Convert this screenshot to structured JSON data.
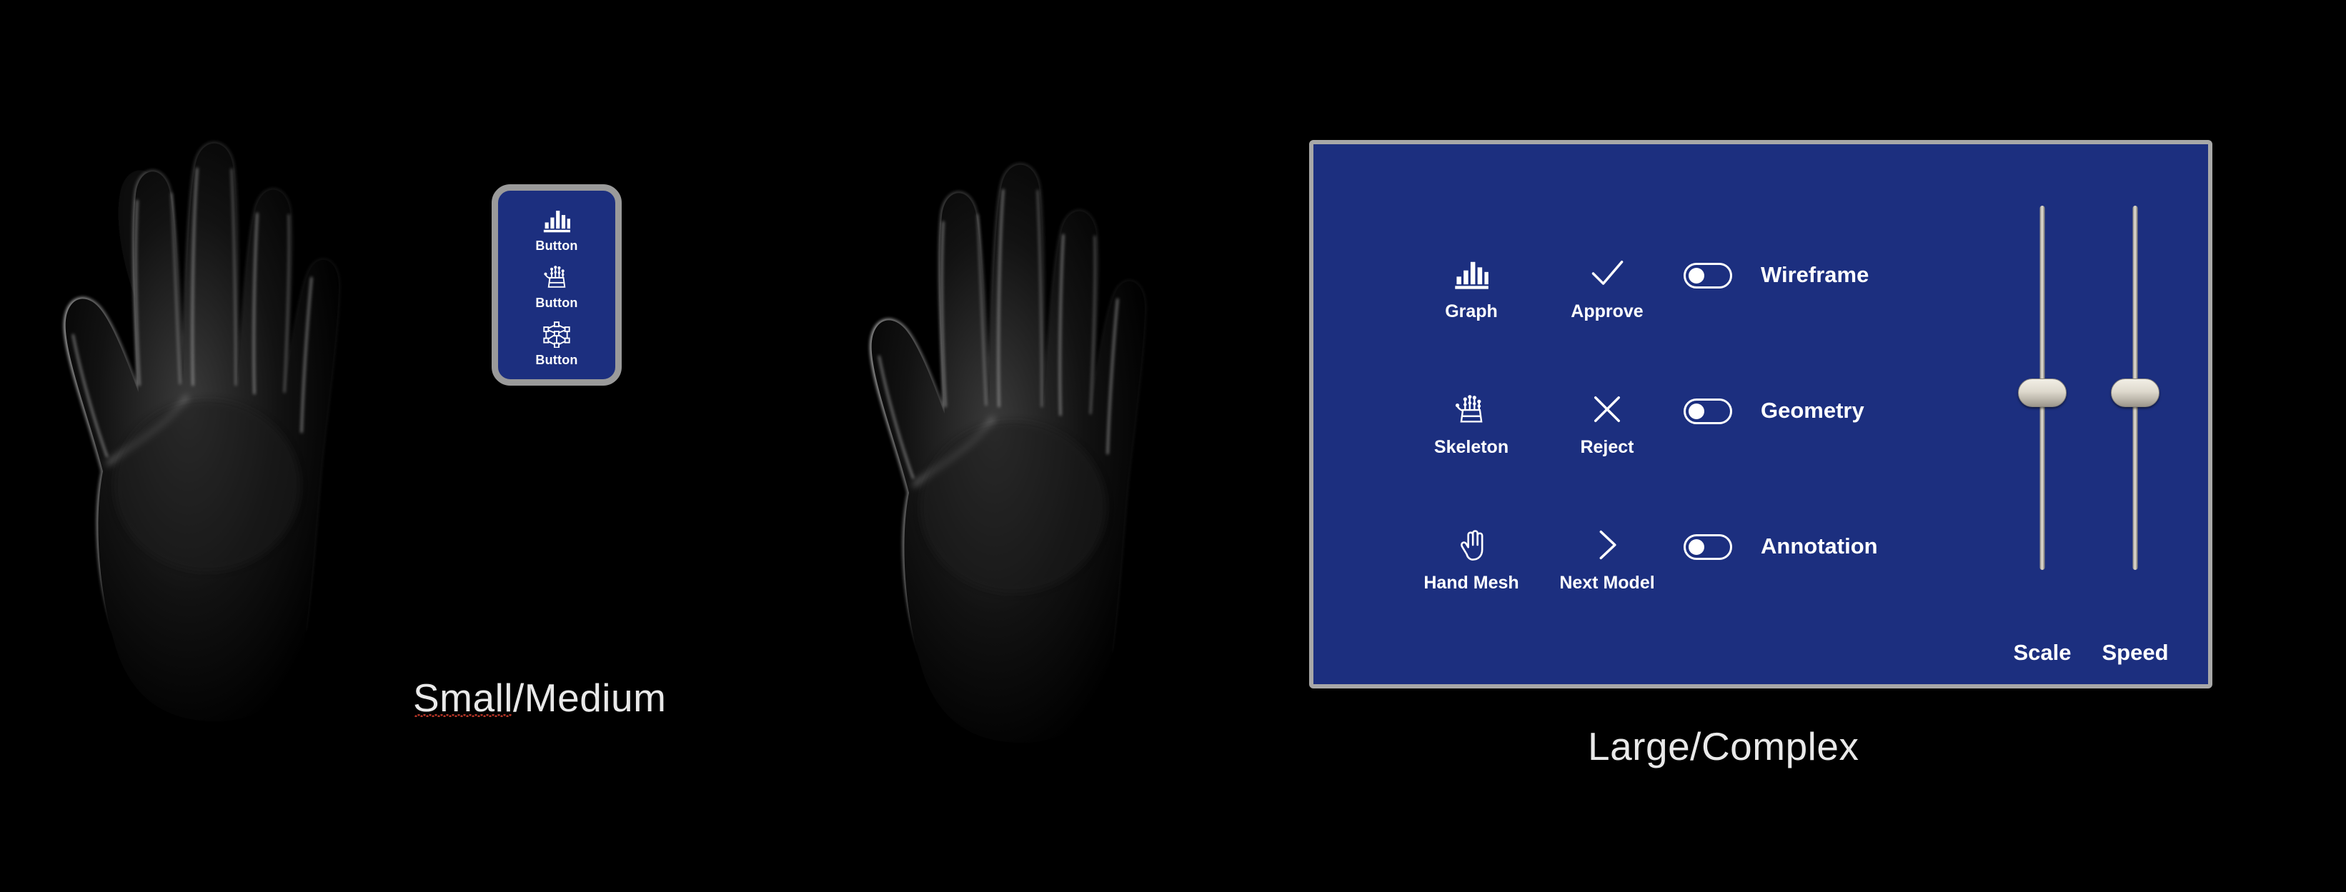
{
  "scene": {
    "background_color": "#000000",
    "panel_fill": "#1C2F7F",
    "panel_border": "#A0A0A0",
    "text_color": "#FFFFFF",
    "caption_color": "#E9E9E9",
    "slider_metal": "#DED9CD",
    "spellcheck_underline": "#C0392B"
  },
  "hands": [
    {
      "name": "hand-left",
      "alt": "hand-silhouette"
    },
    {
      "name": "hand-right",
      "alt": "hand-silhouette"
    }
  ],
  "small_panel": {
    "title": "Small/Medium",
    "buttons": [
      {
        "icon": "bar-graph-icon",
        "label": "Button"
      },
      {
        "icon": "hand-skeleton-icon",
        "label": "Button"
      },
      {
        "icon": "cube-mesh-icon",
        "label": "Button"
      }
    ]
  },
  "large_panel": {
    "title": "Large/Complex",
    "icon_buttons": [
      {
        "icon": "bar-graph-icon",
        "label": "Graph"
      },
      {
        "icon": "checkmark-icon",
        "label": "Approve"
      },
      {
        "icon": "hand-skeleton-icon",
        "label": "Skeleton"
      },
      {
        "icon": "close-x-icon",
        "label": "Reject"
      },
      {
        "icon": "hand-mesh-icon",
        "label": "Hand Mesh"
      },
      {
        "icon": "chevron-right-icon",
        "label": "Next Model"
      }
    ],
    "toggles": [
      {
        "label": "Wireframe",
        "state": "off"
      },
      {
        "label": "Geometry",
        "state": "off"
      },
      {
        "label": "Annotation",
        "state": "off"
      }
    ],
    "sliders": [
      {
        "label": "Scale",
        "value_fraction": 0.48
      },
      {
        "label": "Speed",
        "value_fraction": 0.48
      }
    ]
  },
  "captions": {
    "left_prefix": "Small",
    "left_rest": "/Medium",
    "right": "Large/Complex"
  }
}
